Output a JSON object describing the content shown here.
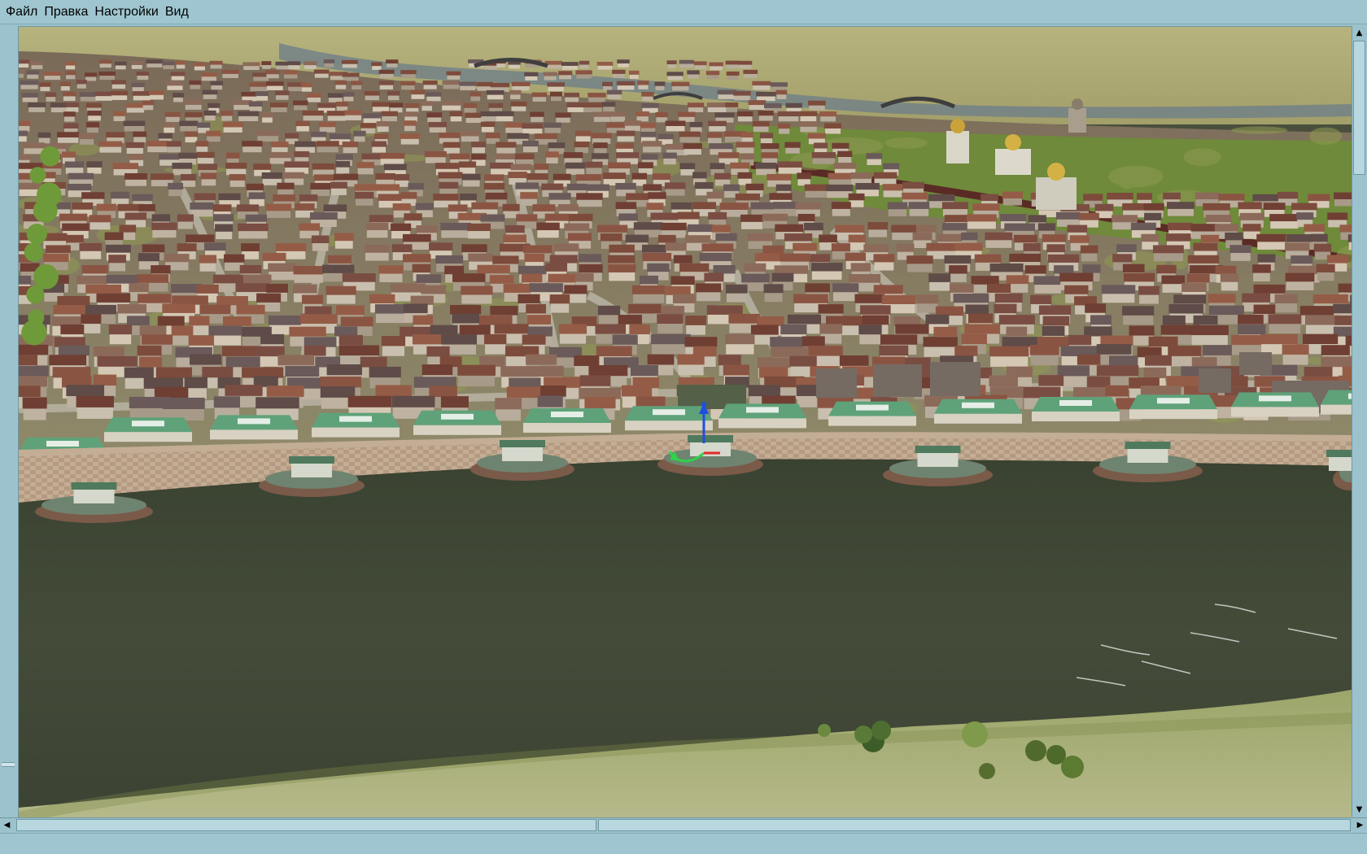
{
  "menu": {
    "items": [
      {
        "label": "Файл"
      },
      {
        "label": "Правка"
      },
      {
        "label": "Настройки"
      },
      {
        "label": "Вид"
      }
    ]
  },
  "colors": {
    "chrome": "#9cc3cd",
    "water": "#3f4636",
    "roof_red": "#7a4a3a",
    "roof_green": "#5fa27a",
    "grass": "#a9a865"
  },
  "icons": {
    "scroll_up": "arrow-up-icon",
    "scroll_down": "arrow-down-icon",
    "scroll_left": "arrow-left-icon",
    "scroll_right": "arrow-right-icon",
    "gizmo": "transform-gizmo-icon"
  }
}
